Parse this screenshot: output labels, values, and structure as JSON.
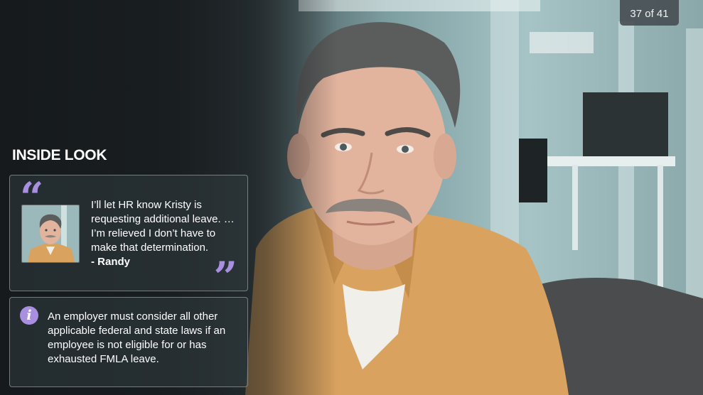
{
  "slide": {
    "counter": "37 of 41"
  },
  "section": {
    "title": "INSIDE LOOK"
  },
  "quote_card": {
    "open_mark": "“",
    "close_mark": "”",
    "text": "I’ll let HR know Kristy is requesting additional leave. … I’m relieved I don’t have to make that determination.",
    "author": "- Randy",
    "avatar_icon": "randy-portrait-icon"
  },
  "info_card": {
    "icon_glyph": "i",
    "icon_name": "info-icon",
    "text": "An employer must consider all other applicable federal and state laws if an employee is not eligible for or has exhausted FMLA leave."
  },
  "colors": {
    "accent": "#a98fe0",
    "shirt": "#d9a25f"
  }
}
